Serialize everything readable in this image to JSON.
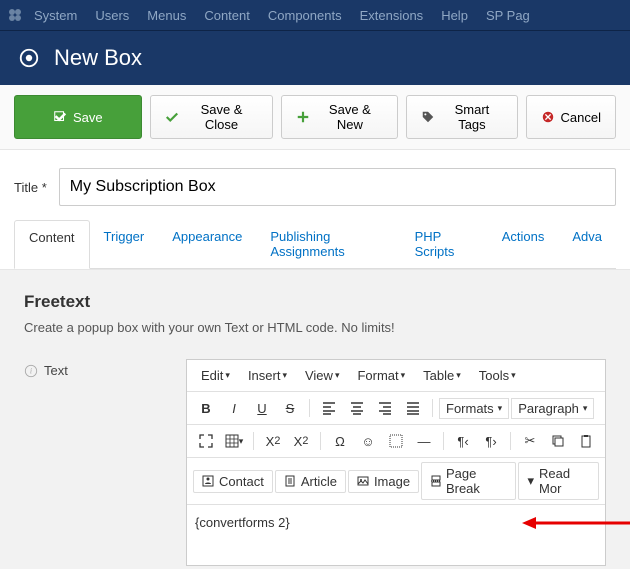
{
  "topmenu": [
    "System",
    "Users",
    "Menus",
    "Content",
    "Components",
    "Extensions",
    "Help",
    "SP Pag"
  ],
  "page_title": "New Box",
  "toolbar": {
    "save": "Save",
    "save_close": "Save & Close",
    "save_new": "Save & New",
    "smart_tags": "Smart Tags",
    "cancel": "Cancel"
  },
  "title_label": "Title *",
  "title_value": "My Subscription Box",
  "tabs": [
    "Content",
    "Trigger",
    "Appearance",
    "Publishing Assignments",
    "PHP Scripts",
    "Actions",
    "Adva"
  ],
  "active_tab": 0,
  "panel": {
    "heading": "Freetext",
    "desc": "Create a popup box with your own Text or HTML code. No limits!",
    "field_label": "Text"
  },
  "editor": {
    "menus": [
      "Edit",
      "Insert",
      "View",
      "Format",
      "Table",
      "Tools"
    ],
    "formats_label": "Formats",
    "paragraph_label": "Paragraph",
    "buttons": {
      "contact": "Contact",
      "article": "Article",
      "image": "Image",
      "page_break": "Page Break",
      "read_more": "Read Mor"
    },
    "content": "{convertforms 2}"
  }
}
